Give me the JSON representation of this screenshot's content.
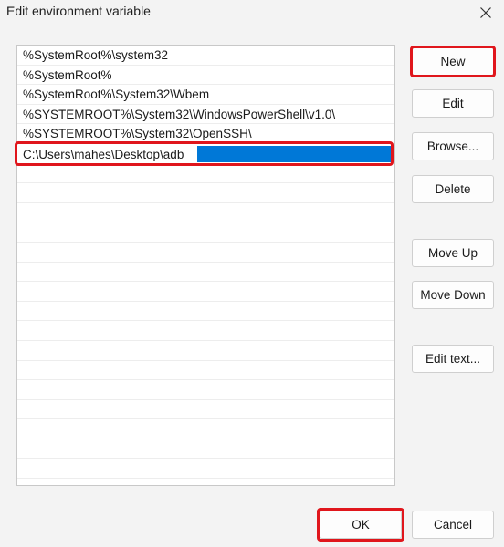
{
  "window": {
    "title": "Edit environment variable",
    "close_icon": "close-icon"
  },
  "paths": [
    "%SystemRoot%\\system32",
    "%SystemRoot%",
    "%SystemRoot%\\System32\\Wbem",
    "%SYSTEMROOT%\\System32\\WindowsPowerShell\\v1.0\\",
    "%SYSTEMROOT%\\System32\\OpenSSH\\"
  ],
  "editing": {
    "value": "C:\\Users\\mahes\\Desktop\\adb"
  },
  "buttons": {
    "new": "New",
    "edit": "Edit",
    "browse": "Browse...",
    "delete": "Delete",
    "move_up": "Move Up",
    "move_down": "Move Down",
    "edit_text": "Edit text...",
    "ok": "OK",
    "cancel": "Cancel"
  },
  "colors": {
    "highlight": "#e0161c",
    "selection": "#0078d7"
  }
}
